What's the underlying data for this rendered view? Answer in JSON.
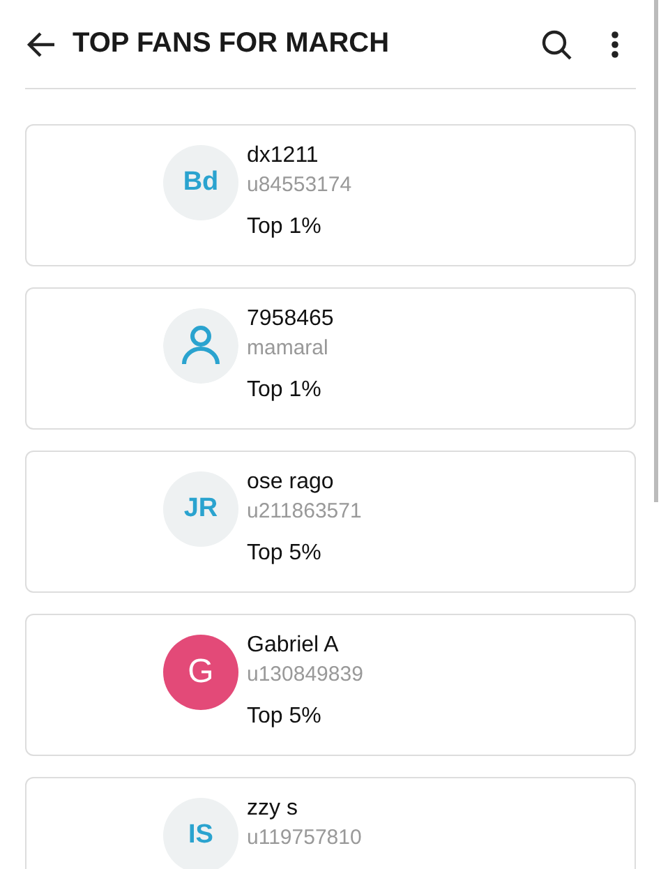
{
  "header": {
    "title": "TOP FANS FOR MARCH"
  },
  "fans": [
    {
      "avatar": {
        "kind": "initials",
        "text": "Bd"
      },
      "name": "dx1211",
      "handle": "u84553174",
      "rank": "Top 1%"
    },
    {
      "avatar": {
        "kind": "person"
      },
      "name": "7958465",
      "handle": "mamaral",
      "rank": "Top 1%"
    },
    {
      "avatar": {
        "kind": "initials",
        "text": "JR"
      },
      "name": "ose rago",
      "handle": "u211863571",
      "rank": "Top 5%"
    },
    {
      "avatar": {
        "kind": "filled",
        "text": "G",
        "color": "#e34a78"
      },
      "name": "Gabriel A",
      "handle": "u130849839",
      "rank": "Top 5%"
    },
    {
      "avatar": {
        "kind": "initials",
        "text": "IS"
      },
      "name": "zzy s",
      "handle": "u119757810"
    }
  ]
}
